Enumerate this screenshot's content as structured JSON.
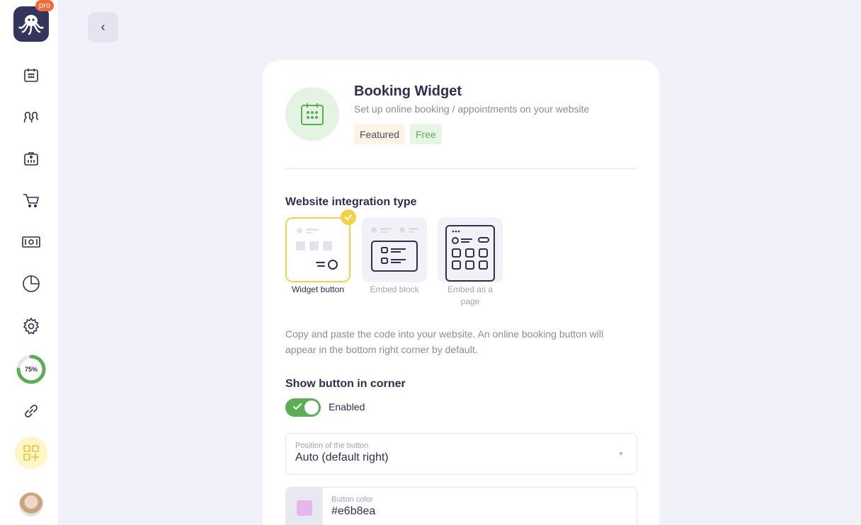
{
  "sidebar": {
    "pro_badge": "pro",
    "progress": {
      "value": 0.75,
      "label": "75%"
    },
    "items": [
      {
        "name": "calendar-icon"
      },
      {
        "name": "clients-icon"
      },
      {
        "name": "team-icon"
      },
      {
        "name": "cart-icon"
      },
      {
        "name": "money-icon"
      },
      {
        "name": "analytics-icon"
      },
      {
        "name": "settings-icon"
      },
      {
        "name": "link-icon"
      },
      {
        "name": "apps-add-icon"
      }
    ]
  },
  "back_button": {
    "label": "‹"
  },
  "widget": {
    "title": "Booking Widget",
    "subtitle": "Set up online booking / appointments on your website",
    "tags": {
      "featured": "Featured",
      "free": "Free"
    }
  },
  "integration": {
    "title": "Website integration type",
    "options": [
      {
        "label": "Widget button",
        "selected": true
      },
      {
        "label": "Embed block",
        "selected": false
      },
      {
        "label": "Embed as a page",
        "selected": false
      }
    ],
    "description": "Copy and paste the code into your website. An online booking button will appear in the bottom right corner by default."
  },
  "corner": {
    "title": "Show button in corner",
    "toggle_label": "Enabled",
    "enabled": true
  },
  "position_field": {
    "label": "Position of the button",
    "value": "Auto (default right)"
  },
  "color_field": {
    "label": "Button color",
    "value": "#e6b8ea"
  },
  "colors": {
    "accent_green": "#5cae55",
    "accent_yellow": "#f3d24a",
    "brand_dark": "#35345e"
  }
}
